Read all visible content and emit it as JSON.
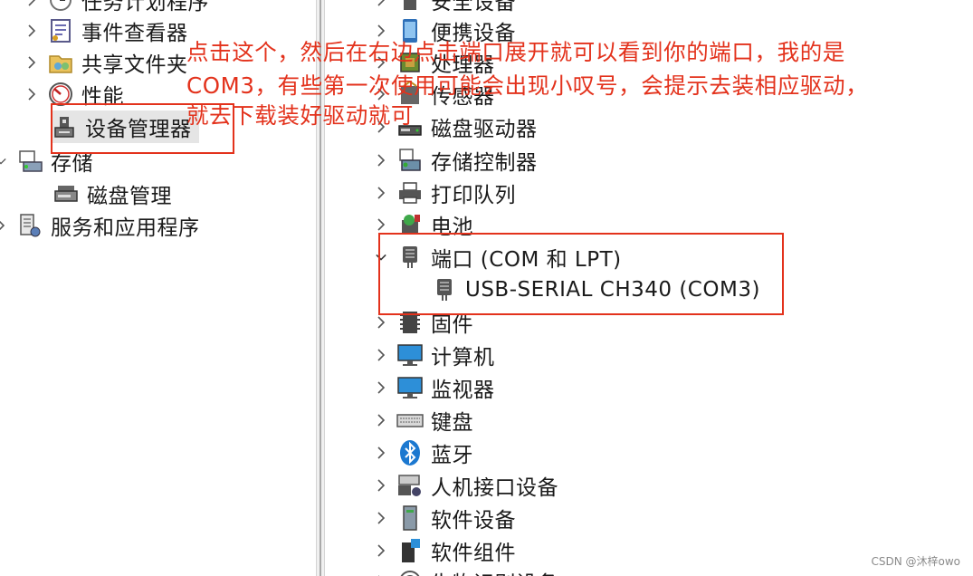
{
  "left_tree": {
    "items": [
      {
        "label": "任务计划程序",
        "icon": "clock-icon"
      },
      {
        "label": "事件查看器",
        "icon": "event-viewer-icon"
      },
      {
        "label": "共享文件夹",
        "icon": "shared-folder-icon"
      },
      {
        "label": "性能",
        "icon": "performance-icon"
      },
      {
        "label": "设备管理器",
        "icon": "device-manager-icon"
      },
      {
        "label": "存储",
        "icon": "storage-icon"
      },
      {
        "label": "磁盘管理",
        "icon": "disk-management-icon"
      },
      {
        "label": "服务和应用程序",
        "icon": "services-icon"
      }
    ]
  },
  "right_tree": {
    "items": [
      {
        "label": "安全设备",
        "icon": "security-device-icon"
      },
      {
        "label": "便携设备",
        "icon": "portable-device-icon"
      },
      {
        "label": "处理器",
        "icon": "processor-icon"
      },
      {
        "label": "传感器",
        "icon": "sensor-icon"
      },
      {
        "label": "磁盘驱动器",
        "icon": "disk-drive-icon"
      },
      {
        "label": "存储控制器",
        "icon": "storage-controller-icon"
      },
      {
        "label": "打印队列",
        "icon": "printer-icon"
      },
      {
        "label": "电池",
        "icon": "battery-icon"
      },
      {
        "label": "端口 (COM 和 LPT)",
        "icon": "port-icon"
      },
      {
        "label": "USB-SERIAL CH340 (COM3)",
        "icon": "port-icon"
      },
      {
        "label": "固件",
        "icon": "firmware-icon"
      },
      {
        "label": "计算机",
        "icon": "computer-icon"
      },
      {
        "label": "监视器",
        "icon": "monitor-icon"
      },
      {
        "label": "键盘",
        "icon": "keyboard-icon"
      },
      {
        "label": "蓝牙",
        "icon": "bluetooth-icon"
      },
      {
        "label": "人机接口设备",
        "icon": "hid-icon"
      },
      {
        "label": "软件设备",
        "icon": "software-device-icon"
      },
      {
        "label": "软件组件",
        "icon": "software-component-icon"
      },
      {
        "label": "生物识别设备",
        "icon": "biometric-icon"
      }
    ]
  },
  "annotation": {
    "line1": "点击这个，然后在右边点击端口展开就可以看到你的端口，我的是",
    "line2": "COM3，有些第一次使用可能会出现小叹号，会提示去装相应驱动，",
    "line3": "就去下载装好驱动就可"
  },
  "watermark": "CSDN @沐梓owo",
  "colors": {
    "annotation_red": "#e3321c",
    "selection": "#e5e5e5"
  }
}
